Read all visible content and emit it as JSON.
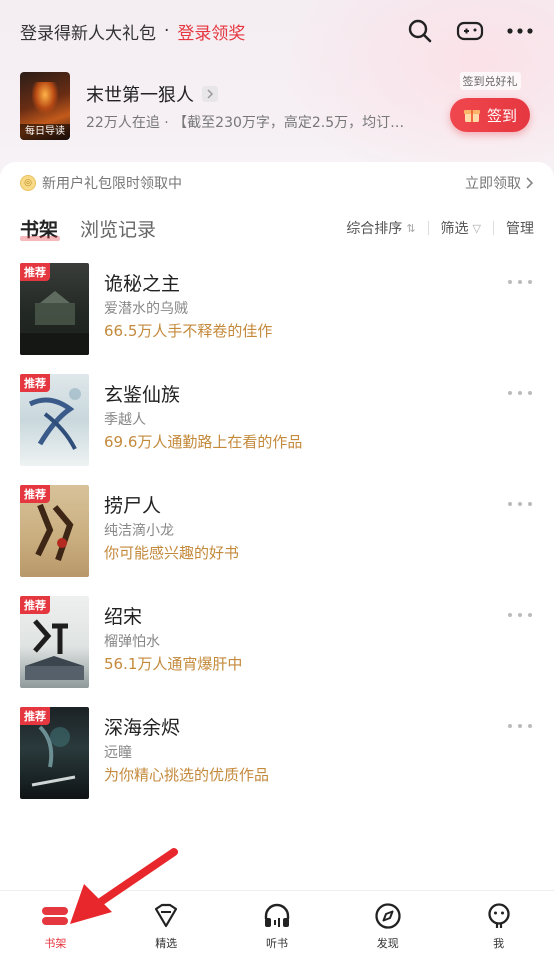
{
  "header": {
    "login_text": "登录得新人大礼包",
    "separator": "·",
    "login_link": "登录领奖",
    "icons": [
      "search-icon",
      "gamepad-icon",
      "more-icon"
    ]
  },
  "banner": {
    "cover_tag": "每日导读",
    "title": "末世第一狠人",
    "subtitle": "22万人在追 · 【截至230万字，高定2.5万，均订…",
    "checkin_label": "签到兑好礼",
    "checkin_button": "签到"
  },
  "promo": {
    "text": "新用户礼包限时领取中",
    "link": "立即领取"
  },
  "tabs": {
    "shelf": "书架",
    "history": "浏览记录",
    "sort": "综合排序",
    "filter": "筛选",
    "manage": "管理"
  },
  "books": [
    {
      "badge": "推荐",
      "title": "诡秘之主",
      "author": "爱潜水的乌贼",
      "desc": "66.5万人手不释卷的佳作"
    },
    {
      "badge": "推荐",
      "title": "玄鉴仙族",
      "author": "季越人",
      "desc": "69.6万人通勤路上在看的作品"
    },
    {
      "badge": "推荐",
      "title": "捞尸人",
      "author": "纯洁滴小龙",
      "desc": "你可能感兴趣的好书"
    },
    {
      "badge": "推荐",
      "title": "绍宋",
      "author": "榴弹怕水",
      "desc": "56.1万人通宵爆肝中"
    },
    {
      "badge": "推荐",
      "title": "深海余烬",
      "author": "远瞳",
      "desc": "为你精心挑选的优质作品"
    }
  ],
  "nav": [
    {
      "label": "书架",
      "icon": "bookshelf-icon"
    },
    {
      "label": "精选",
      "icon": "diamond-icon"
    },
    {
      "label": "听书",
      "icon": "headphones-icon"
    },
    {
      "label": "发现",
      "icon": "compass-icon"
    },
    {
      "label": "我",
      "icon": "profile-icon"
    }
  ],
  "colors": {
    "accent": "#e5373f",
    "desc_gold": "#c48a3c"
  }
}
